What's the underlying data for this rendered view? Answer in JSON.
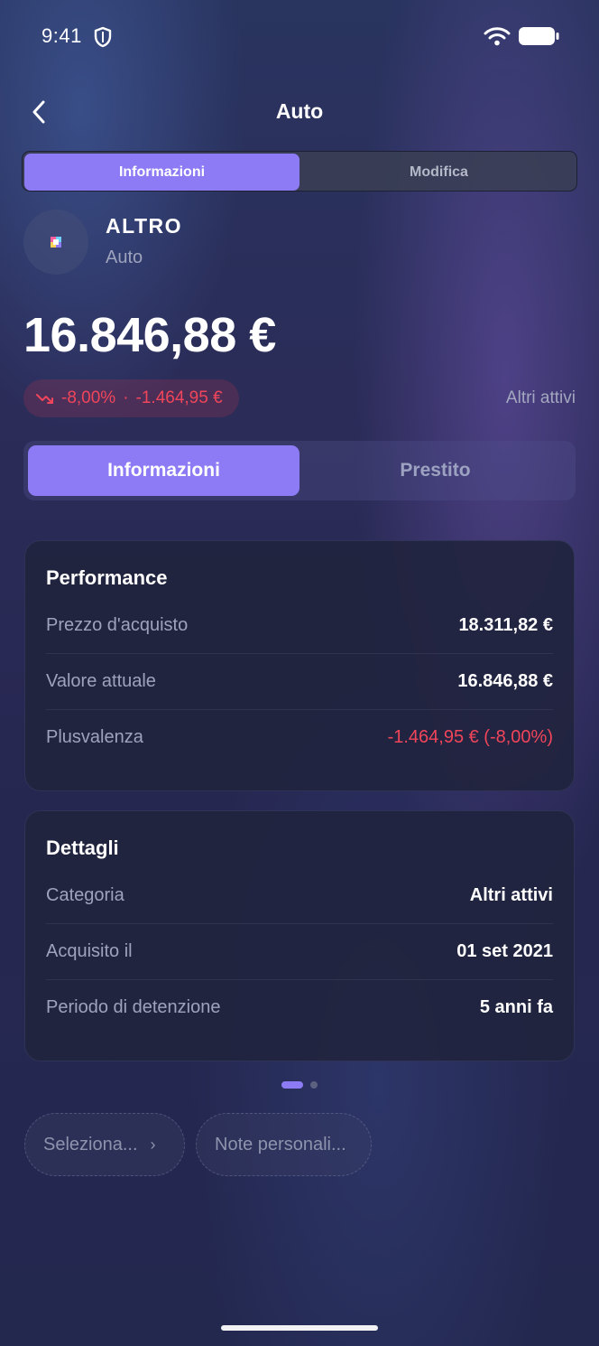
{
  "status_bar": {
    "time": "9:41"
  },
  "nav": {
    "title": "Auto"
  },
  "top_tabs": [
    {
      "label": "Informazioni",
      "active": true
    },
    {
      "label": "Modifica",
      "active": false
    }
  ],
  "asset": {
    "name": "ALTRO",
    "type": "Auto",
    "total_value": "16.846,88 €",
    "change_percent": "-8,00%",
    "change_separator": "·",
    "change_amount": "-1.464,95 €",
    "category_link": "Altri attivi"
  },
  "main_tabs": [
    {
      "label": "Informazioni",
      "active": true
    },
    {
      "label": "Prestito",
      "active": false
    }
  ],
  "performance": {
    "title": "Performance",
    "rows": [
      {
        "label": "Prezzo d'acquisto",
        "value": "18.311,82 €"
      },
      {
        "label": "Valore attuale",
        "value": "16.846,88 €"
      },
      {
        "label": "Plusvalenza",
        "value": "-1.464,95 € (-8,00%)"
      }
    ]
  },
  "details": {
    "title": "Dettagli",
    "rows": [
      {
        "label": "Categoria",
        "value": "Altri attivi"
      },
      {
        "label": "Acquisito il",
        "value": "01 set 2021"
      },
      {
        "label": "Periodo di detenzione",
        "value": "5 anni fa"
      }
    ]
  },
  "pagination": {
    "current": 1,
    "total": 2
  },
  "chips": {
    "select_label": "Seleziona...",
    "notes_label": "Note personali..."
  },
  "colors": {
    "accent": "#8c7bf5",
    "negative": "#f0455a",
    "card": "#21243e"
  },
  "icons": [
    "shield-icon",
    "wifi-icon",
    "battery-icon",
    "back-chevron-icon",
    "trend-down-icon",
    "chevron-right-icon",
    "asset-logo-icon"
  ]
}
